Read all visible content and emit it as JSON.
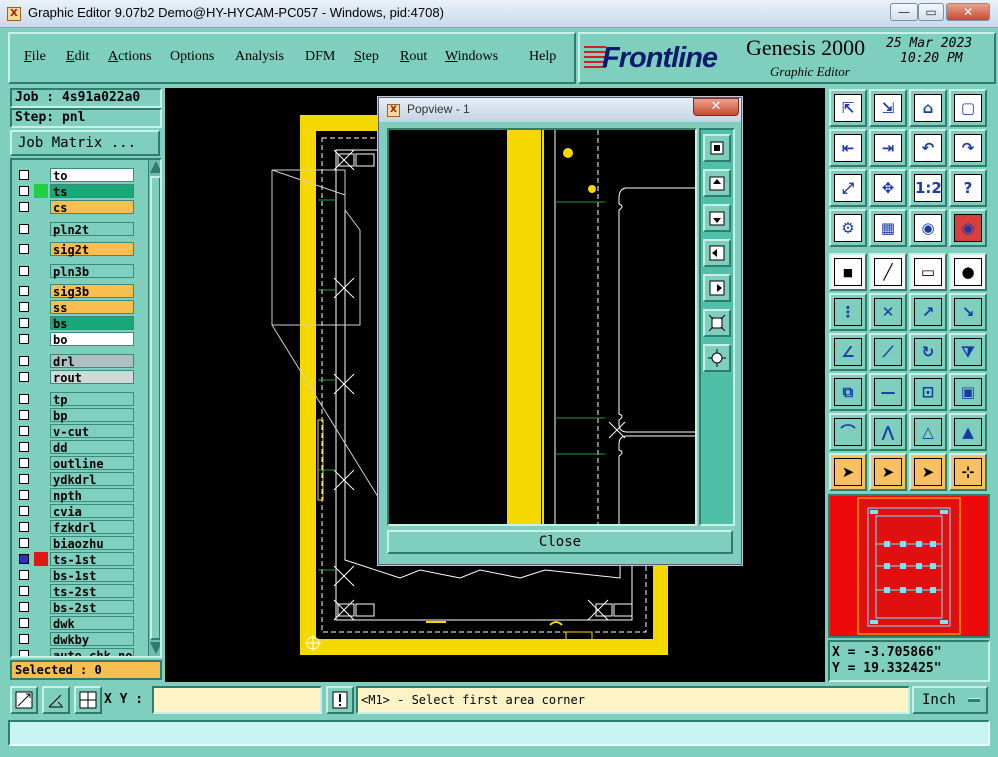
{
  "window": {
    "title": "Graphic Editor 9.07b2 Demo@HY-HYCAM-PC057 - Windows, pid:4708)",
    "minimize": "—",
    "restore": "▭",
    "close": "✕"
  },
  "menu": [
    {
      "label": "File"
    },
    {
      "label": "Edit"
    },
    {
      "label": "Actions"
    },
    {
      "label": "Options"
    },
    {
      "label": "Analysis"
    },
    {
      "label": "DFM"
    },
    {
      "label": "Step"
    },
    {
      "label": "Rout"
    },
    {
      "label": "Windows"
    },
    {
      "label": "Help"
    }
  ],
  "brand": {
    "logo": "Frontline",
    "product": "Genesis 2000",
    "subtitle": "Graphic Editor",
    "date": "25 Mar 2023",
    "time": "10:20 PM"
  },
  "job": {
    "job_label": "Job : 4s91a022a0",
    "step_label": "Step: pnl",
    "matrix_button": "Job Matrix ..."
  },
  "layers": [
    {
      "name": "to",
      "color": "#ffffff",
      "affected": false
    },
    {
      "name": "ts",
      "color": "#1aa878",
      "affected": true,
      "aff_color": "#20d040"
    },
    {
      "name": "cs",
      "color": "#f8bf50",
      "affected": false
    },
    {
      "name": "pln2t",
      "color": "#7fcfbf",
      "affected": false
    },
    {
      "name": "sig2t",
      "color": "#f8bf50",
      "affected": false
    },
    {
      "name": "pln3b",
      "color": "#7fcfbf",
      "affected": false
    },
    {
      "name": "sig3b",
      "color": "#f8bf50",
      "affected": false
    },
    {
      "name": "ss",
      "color": "#f8bf50",
      "affected": false
    },
    {
      "name": "bs",
      "color": "#1aa878",
      "affected": false
    },
    {
      "name": "bo",
      "color": "#ffffff",
      "affected": false
    },
    {
      "name": "drl",
      "color": "#b0c0c0",
      "affected": false
    },
    {
      "name": "rout",
      "color": "#d0d8d8",
      "affected": false
    },
    {
      "name": "tp",
      "color": "#7fcfbf",
      "affected": false
    },
    {
      "name": "bp",
      "color": "#7fcfbf",
      "affected": false
    },
    {
      "name": "v-cut",
      "color": "#7fcfbf",
      "affected": false
    },
    {
      "name": "dd",
      "color": "#7fcfbf",
      "affected": false
    },
    {
      "name": "outline",
      "color": "#7fcfbf",
      "affected": false
    },
    {
      "name": "ydkdrl",
      "color": "#7fcfbf",
      "affected": false
    },
    {
      "name": "npth",
      "color": "#7fcfbf",
      "affected": false
    },
    {
      "name": "cvia",
      "color": "#7fcfbf",
      "affected": false
    },
    {
      "name": "fzkdrl",
      "color": "#7fcfbf",
      "affected": false
    },
    {
      "name": "biaozhu",
      "color": "#7fcfbf",
      "affected": false
    },
    {
      "name": "ts-1st",
      "color": "#7fcfbf",
      "affected": true,
      "aff_color": "#e01818",
      "work": true
    },
    {
      "name": "bs-1st",
      "color": "#7fcfbf",
      "affected": false
    },
    {
      "name": "ts-2st",
      "color": "#7fcfbf",
      "affected": false
    },
    {
      "name": "bs-2st",
      "color": "#7fcfbf",
      "affected": false
    },
    {
      "name": "dwk",
      "color": "#7fcfbf",
      "affected": false
    },
    {
      "name": "dwkby",
      "color": "#7fcfbf",
      "affected": false
    },
    {
      "name": "auto_chk_no",
      "color": "#7fcfbf",
      "affected": false
    }
  ],
  "selected": "Selected : 0",
  "popview": {
    "title": "Popview - 1",
    "close_x": "✕",
    "close_button": "Close"
  },
  "coords": {
    "x": "X = -3.705866\"",
    "y": "Y = 19.332425\""
  },
  "bottom": {
    "xy_label": "X Y :",
    "xy_value": "",
    "prompt": "<M1> - Select first area corner",
    "unit": "Inch"
  },
  "colors": {
    "panel": "#7fcfbf",
    "board_yellow": "#f5d800",
    "minimap_red": "#ee0a0a",
    "highlight_orange": "#f8bf50"
  }
}
